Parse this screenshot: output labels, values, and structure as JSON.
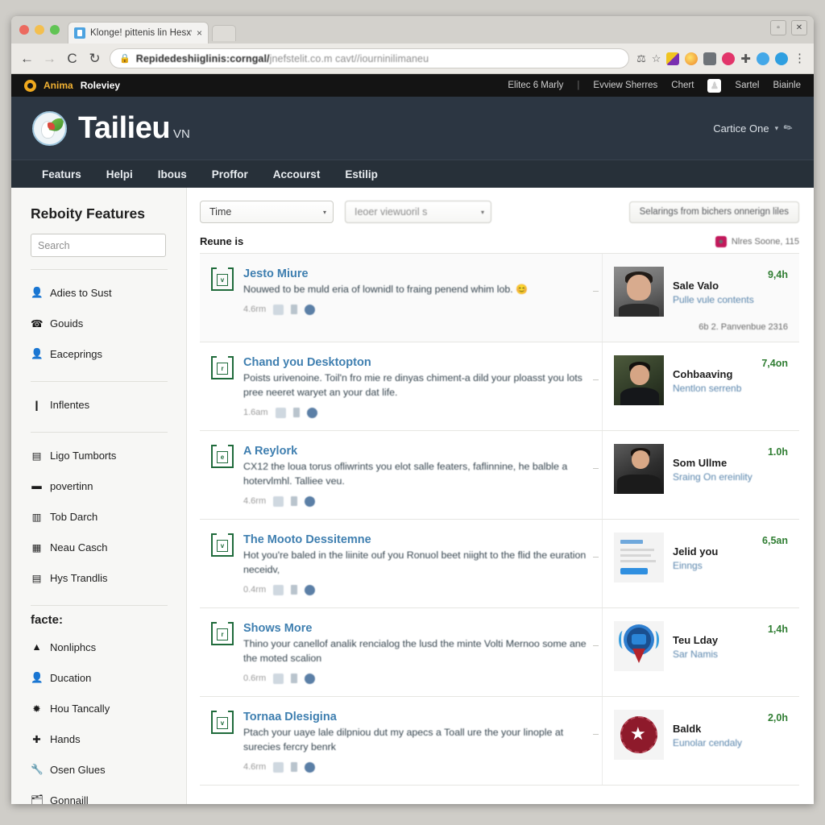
{
  "browser": {
    "tab": {
      "title": "Klonge! pittenis lin Hesxwne",
      "close_label": "×"
    },
    "window_buttons": {
      "restore": "▫",
      "close": "✕"
    },
    "nav": {
      "back": "←",
      "forward": "→",
      "reload": "C",
      "home": "↻"
    },
    "url": {
      "lock": "🔒",
      "text": "Repidedeshiiglinis:corngal/",
      "text_faded": "jnefstelit.co.m cavt//iourninilimaneu"
    },
    "omni_icons": [
      "pin-icon",
      "star-icon"
    ],
    "extension_icons": [
      "ext-color-icon",
      "ext-badge-icon",
      "ext-gray-icon",
      "ext-pink-icon",
      "add-icon",
      "ext-blue-icon",
      "ext-cyan-icon",
      "menu-kebab-icon"
    ]
  },
  "utility_bar": {
    "brand_first": "Anima",
    "brand_second": "Roleviey",
    "links": [
      "Elitec 6 Marly",
      "|",
      "Evview Sherres",
      "Chert",
      "Sartel",
      "Biainle"
    ],
    "user_chip": "👤"
  },
  "site_header": {
    "logo_text": "Tailieu",
    "logo_sup": "VN",
    "account": "Cartice One",
    "account_caret": "▾",
    "account_pen": "✎"
  },
  "site_nav": {
    "items": [
      "Featurs",
      "Helpi",
      "Ibous",
      "Proffor",
      "Accourst",
      "Estilip"
    ]
  },
  "sidebar": {
    "title": "Reboity Features",
    "search_placeholder": "Search",
    "search_value": "",
    "search_icon": "⚲",
    "group_1": [
      {
        "icon": "👤",
        "label": "Adies to Sust"
      },
      {
        "icon": "☎",
        "label": "Gouids"
      },
      {
        "icon": "👤",
        "label": "Eaceprings"
      }
    ],
    "group_2": [
      {
        "icon": "❙",
        "label": "Inflentes"
      }
    ],
    "group_3": [
      {
        "icon": "▤",
        "label": "Ligo Tumborts"
      },
      {
        "icon": "▬",
        "label": "povertinn"
      },
      {
        "icon": "▥",
        "label": "Tob Darch"
      },
      {
        "icon": "▦",
        "label": "Neau Casch"
      },
      {
        "icon": "▤",
        "label": "Hys Trandlis"
      }
    ],
    "section_head": "facte:",
    "group_4": [
      {
        "icon": "▲",
        "label": "Nonliphcs"
      },
      {
        "icon": "👤",
        "label": "Ducation"
      },
      {
        "icon": "✹",
        "label": "Hou Tancally"
      },
      {
        "icon": "✚",
        "label": "Hands"
      },
      {
        "icon": "🔧",
        "label": "Osen Glues"
      },
      {
        "icon": "🗂",
        "label": "Gonnaill"
      }
    ]
  },
  "main": {
    "select_time": {
      "value": "Time",
      "caret": "▾"
    },
    "select_view": {
      "value": "Ieoer viewuoril s",
      "caret": "▾"
    },
    "settings_button": "Selarings from bichers onnerign liles",
    "results_label": "Reune is",
    "filter_note": {
      "badge": "●",
      "text": "Nlres Soone, 115"
    },
    "rows": [
      {
        "doc_letter": "v",
        "title": "Jesto Miure",
        "desc": "Nouwed to be muld eria of lownidl to fraing penend whim lob.",
        "emoji": "😊",
        "meta_time": "4.6rm",
        "thumb": "ph-a",
        "name": "Sale Valo",
        "sub": "Pulle vule contents",
        "time": "9,4h",
        "foot": "6b 2. Panvenbue 2316"
      },
      {
        "doc_letter": "r",
        "title": "Chand you Desktopton",
        "desc": "Poists urivenoine. Toil'n fro mie re dinyas chiment-a dild your ploasst you lots pree neeret waryet an your dat life.",
        "emoji": "",
        "meta_time": "1.6am",
        "thumb": "ph-b",
        "name": "Cohbaaving",
        "sub": "Nentlon serrenb",
        "time": "7,4on",
        "foot": ""
      },
      {
        "doc_letter": "e",
        "title": "A Reylork",
        "desc": "CX12 the loua torus ofliwrints you elot salle featers, faflinnine, he balble a hotervlmhl. Talliee veu.",
        "emoji": "",
        "meta_time": "4.6rm",
        "thumb": "ph-c",
        "name": "Som Ullme",
        "sub": "Sraing On ereinlity",
        "time": "1.0h",
        "foot": ""
      },
      {
        "doc_letter": "v",
        "title": "The Mooto Dessitemne",
        "desc": "Hot you're baled in the liinite ouf you Ronuol beet niight to the flid the euration neceidv,",
        "emoji": "",
        "meta_time": "0.4rm",
        "thumb": "ph-doc",
        "name": "Jelid you",
        "sub": "Einngs",
        "time": "6,5an",
        "foot": ""
      },
      {
        "doc_letter": "r",
        "title": "Shows More",
        "desc": "Thino your canellof analik rencialog the lusd the minte Volti Mernoo some ane the moted scalion",
        "emoji": "",
        "meta_time": "0.6rm",
        "thumb": "ph-pin",
        "name": "Teu Lday",
        "sub": "Sar Namis",
        "time": "1,4h",
        "foot": ""
      },
      {
        "doc_letter": "v",
        "title": "Tornaa Dlesigina",
        "desc": "Ptach your uaye lale dilpniou dut my apecs a Toall ure the your linople at surecies fercry benrk",
        "emoji": "",
        "meta_time": "4.6rm",
        "thumb": "ph-seal",
        "name": "Baldk",
        "sub": "Eunolar cendaly",
        "time": "2,0h",
        "foot": ""
      }
    ]
  },
  "colors": {
    "header_navy": "#2c3642",
    "nav_navy": "#273039",
    "util_black": "#141414",
    "brand_gold": "#f2b233",
    "link_blue": "#3f7fb0",
    "time_green": "#2f7d32",
    "doc_green": "#1f6b3b"
  }
}
